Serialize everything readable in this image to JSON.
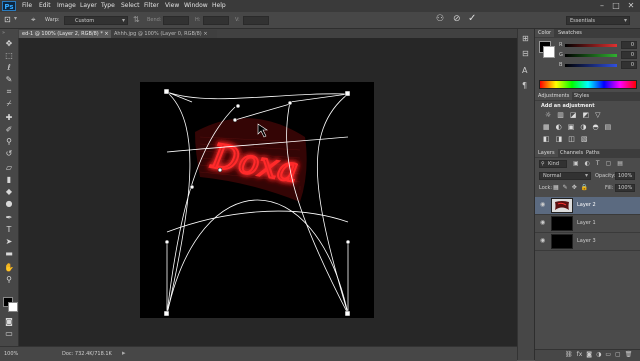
{
  "app": {
    "logo": "Ps"
  },
  "menubar": {
    "items": [
      "File",
      "Edit",
      "Image",
      "Layer",
      "Type",
      "Select",
      "Filter",
      "View",
      "Window",
      "Help"
    ],
    "window_controls": {
      "minimize": "–",
      "maximize": "□",
      "close": "✕"
    }
  },
  "options": {
    "warp_label": "Warp:",
    "warp_value": "Custom",
    "bend_label": "Bend:",
    "h_label": "H:",
    "v_label": "V:",
    "workspace": "Essentials"
  },
  "tabs": [
    {
      "label": "ed-1 @ 100% (Layer 2, RGB/8) * ×",
      "active": true
    },
    {
      "label": "Ahhh.jpg @ 100% (Layer 0, RGB/8) ×",
      "active": false
    }
  ],
  "status": {
    "zoom": "100%",
    "doc": "Doc: 732.4K/718.1K"
  },
  "color_panel": {
    "tabs": [
      "Color",
      "Swatches"
    ],
    "channels": [
      {
        "name": "R",
        "value": "0",
        "color": "#e03030"
      },
      {
        "name": "G",
        "value": "0",
        "color": "#30b030"
      },
      {
        "name": "B",
        "value": "0",
        "color": "#3050e0"
      }
    ]
  },
  "adjustments_panel": {
    "tabs": [
      "Adjustments",
      "Styles"
    ],
    "heading": "Add an adjustment",
    "row1": [
      "☼",
      "▥",
      "◪",
      "◩",
      "▽"
    ],
    "row2": [
      "▦",
      "◐",
      "▣",
      "◑",
      "◓",
      "▤"
    ],
    "row3": [
      "◧",
      "◨",
      "◫",
      "▧"
    ]
  },
  "layers_panel": {
    "tabs": [
      "Layers",
      "Channels",
      "Paths"
    ],
    "kind_label": "Kind",
    "blend_mode": "Normal",
    "opacity_label": "Opacity:",
    "opacity_value": "100%",
    "lock_label": "Lock:",
    "fill_label": "Fill:",
    "fill_value": "100%",
    "layers": [
      {
        "name": "Layer 2",
        "selected": true
      },
      {
        "name": "Layer 1",
        "selected": false
      },
      {
        "name": "Layer 3",
        "selected": false
      }
    ],
    "bottom_icons": [
      "⛓",
      "fx",
      "◙",
      "◑",
      "▭",
      "▢",
      "🗑"
    ]
  },
  "canvas": {
    "text": "Doxa",
    "neon_color": "#ff2a2a",
    "accent": "#1473e6"
  }
}
